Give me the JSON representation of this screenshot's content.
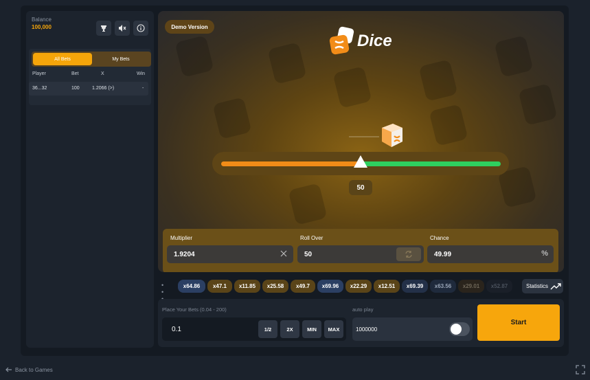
{
  "balance": {
    "label": "Balance",
    "value": "100,000"
  },
  "bets": {
    "tabs": [
      "All Bets",
      "My Bets"
    ],
    "columns": [
      "Player",
      "Bet",
      "X",
      "Win"
    ],
    "rows": [
      {
        "player": "36...32",
        "bet": "100",
        "x": "1.2066 (>)",
        "win": "-"
      }
    ]
  },
  "game": {
    "demo_label": "Demo Version",
    "logo_text": "Dice",
    "slider_value": "50",
    "slider_position": 0.5
  },
  "params": {
    "multiplier": {
      "label": "Multiplier",
      "value": "1.9204"
    },
    "roll_over": {
      "label": "Roll Over",
      "value": "50"
    },
    "chance": {
      "label": "Chance",
      "value": "49.99",
      "suffix": "%"
    }
  },
  "history": {
    "items": [
      "x64.86",
      "x47.1",
      "x11.85",
      "x25.58",
      "x49.7",
      "x69.96",
      "x22.29",
      "x12.51",
      "x69.39",
      "x63.56",
      "x29.01",
      "x52.87"
    ],
    "stats_label": "Statistics"
  },
  "bet": {
    "label": "Place Your Bets (0.04 - 200)",
    "value": "0.1",
    "quick": [
      "1/2",
      "2X",
      "MIN",
      "MAX"
    ],
    "auto_label": "auto play",
    "auto_value": "1000000",
    "auto_enabled": false,
    "start_label": "Start"
  },
  "footer": {
    "back_label": "Back to Games"
  },
  "colors": {
    "accent": "#f5a50a",
    "over": "#2ecf5f",
    "under": "#f28c18"
  }
}
